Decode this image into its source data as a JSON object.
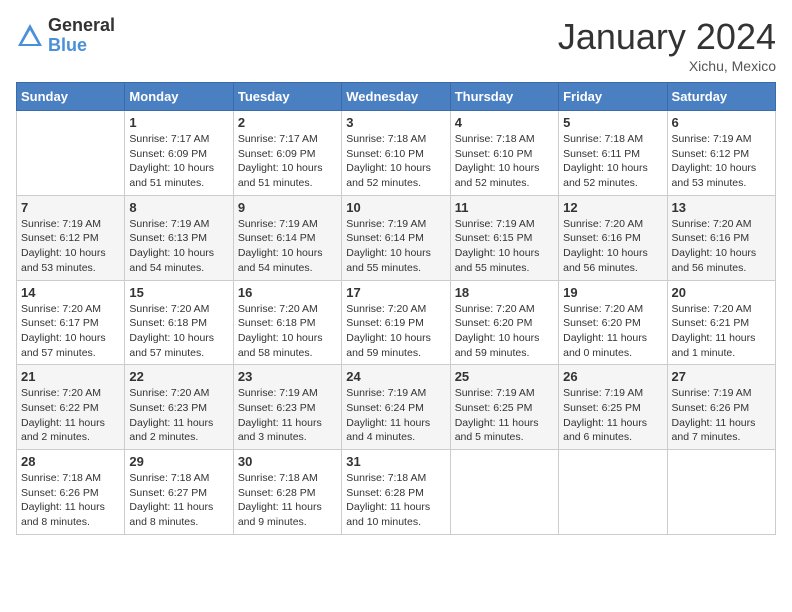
{
  "logo": {
    "general": "General",
    "blue": "Blue"
  },
  "title": "January 2024",
  "subtitle": "Xichu, Mexico",
  "days_of_week": [
    "Sunday",
    "Monday",
    "Tuesday",
    "Wednesday",
    "Thursday",
    "Friday",
    "Saturday"
  ],
  "weeks": [
    [
      {
        "day": "",
        "info": ""
      },
      {
        "day": "1",
        "info": "Sunrise: 7:17 AM\nSunset: 6:09 PM\nDaylight: 10 hours\nand 51 minutes."
      },
      {
        "day": "2",
        "info": "Sunrise: 7:17 AM\nSunset: 6:09 PM\nDaylight: 10 hours\nand 51 minutes."
      },
      {
        "day": "3",
        "info": "Sunrise: 7:18 AM\nSunset: 6:10 PM\nDaylight: 10 hours\nand 52 minutes."
      },
      {
        "day": "4",
        "info": "Sunrise: 7:18 AM\nSunset: 6:10 PM\nDaylight: 10 hours\nand 52 minutes."
      },
      {
        "day": "5",
        "info": "Sunrise: 7:18 AM\nSunset: 6:11 PM\nDaylight: 10 hours\nand 52 minutes."
      },
      {
        "day": "6",
        "info": "Sunrise: 7:19 AM\nSunset: 6:12 PM\nDaylight: 10 hours\nand 53 minutes."
      }
    ],
    [
      {
        "day": "7",
        "info": "Sunrise: 7:19 AM\nSunset: 6:12 PM\nDaylight: 10 hours\nand 53 minutes."
      },
      {
        "day": "8",
        "info": "Sunrise: 7:19 AM\nSunset: 6:13 PM\nDaylight: 10 hours\nand 54 minutes."
      },
      {
        "day": "9",
        "info": "Sunrise: 7:19 AM\nSunset: 6:14 PM\nDaylight: 10 hours\nand 54 minutes."
      },
      {
        "day": "10",
        "info": "Sunrise: 7:19 AM\nSunset: 6:14 PM\nDaylight: 10 hours\nand 55 minutes."
      },
      {
        "day": "11",
        "info": "Sunrise: 7:19 AM\nSunset: 6:15 PM\nDaylight: 10 hours\nand 55 minutes."
      },
      {
        "day": "12",
        "info": "Sunrise: 7:20 AM\nSunset: 6:16 PM\nDaylight: 10 hours\nand 56 minutes."
      },
      {
        "day": "13",
        "info": "Sunrise: 7:20 AM\nSunset: 6:16 PM\nDaylight: 10 hours\nand 56 minutes."
      }
    ],
    [
      {
        "day": "14",
        "info": "Sunrise: 7:20 AM\nSunset: 6:17 PM\nDaylight: 10 hours\nand 57 minutes."
      },
      {
        "day": "15",
        "info": "Sunrise: 7:20 AM\nSunset: 6:18 PM\nDaylight: 10 hours\nand 57 minutes."
      },
      {
        "day": "16",
        "info": "Sunrise: 7:20 AM\nSunset: 6:18 PM\nDaylight: 10 hours\nand 58 minutes."
      },
      {
        "day": "17",
        "info": "Sunrise: 7:20 AM\nSunset: 6:19 PM\nDaylight: 10 hours\nand 59 minutes."
      },
      {
        "day": "18",
        "info": "Sunrise: 7:20 AM\nSunset: 6:20 PM\nDaylight: 10 hours\nand 59 minutes."
      },
      {
        "day": "19",
        "info": "Sunrise: 7:20 AM\nSunset: 6:20 PM\nDaylight: 11 hours\nand 0 minutes."
      },
      {
        "day": "20",
        "info": "Sunrise: 7:20 AM\nSunset: 6:21 PM\nDaylight: 11 hours\nand 1 minute."
      }
    ],
    [
      {
        "day": "21",
        "info": "Sunrise: 7:20 AM\nSunset: 6:22 PM\nDaylight: 11 hours\nand 2 minutes."
      },
      {
        "day": "22",
        "info": "Sunrise: 7:20 AM\nSunset: 6:23 PM\nDaylight: 11 hours\nand 2 minutes."
      },
      {
        "day": "23",
        "info": "Sunrise: 7:19 AM\nSunset: 6:23 PM\nDaylight: 11 hours\nand 3 minutes."
      },
      {
        "day": "24",
        "info": "Sunrise: 7:19 AM\nSunset: 6:24 PM\nDaylight: 11 hours\nand 4 minutes."
      },
      {
        "day": "25",
        "info": "Sunrise: 7:19 AM\nSunset: 6:25 PM\nDaylight: 11 hours\nand 5 minutes."
      },
      {
        "day": "26",
        "info": "Sunrise: 7:19 AM\nSunset: 6:25 PM\nDaylight: 11 hours\nand 6 minutes."
      },
      {
        "day": "27",
        "info": "Sunrise: 7:19 AM\nSunset: 6:26 PM\nDaylight: 11 hours\nand 7 minutes."
      }
    ],
    [
      {
        "day": "28",
        "info": "Sunrise: 7:18 AM\nSunset: 6:26 PM\nDaylight: 11 hours\nand 8 minutes."
      },
      {
        "day": "29",
        "info": "Sunrise: 7:18 AM\nSunset: 6:27 PM\nDaylight: 11 hours\nand 8 minutes."
      },
      {
        "day": "30",
        "info": "Sunrise: 7:18 AM\nSunset: 6:28 PM\nDaylight: 11 hours\nand 9 minutes."
      },
      {
        "day": "31",
        "info": "Sunrise: 7:18 AM\nSunset: 6:28 PM\nDaylight: 11 hours\nand 10 minutes."
      },
      {
        "day": "",
        "info": ""
      },
      {
        "day": "",
        "info": ""
      },
      {
        "day": "",
        "info": ""
      }
    ]
  ]
}
